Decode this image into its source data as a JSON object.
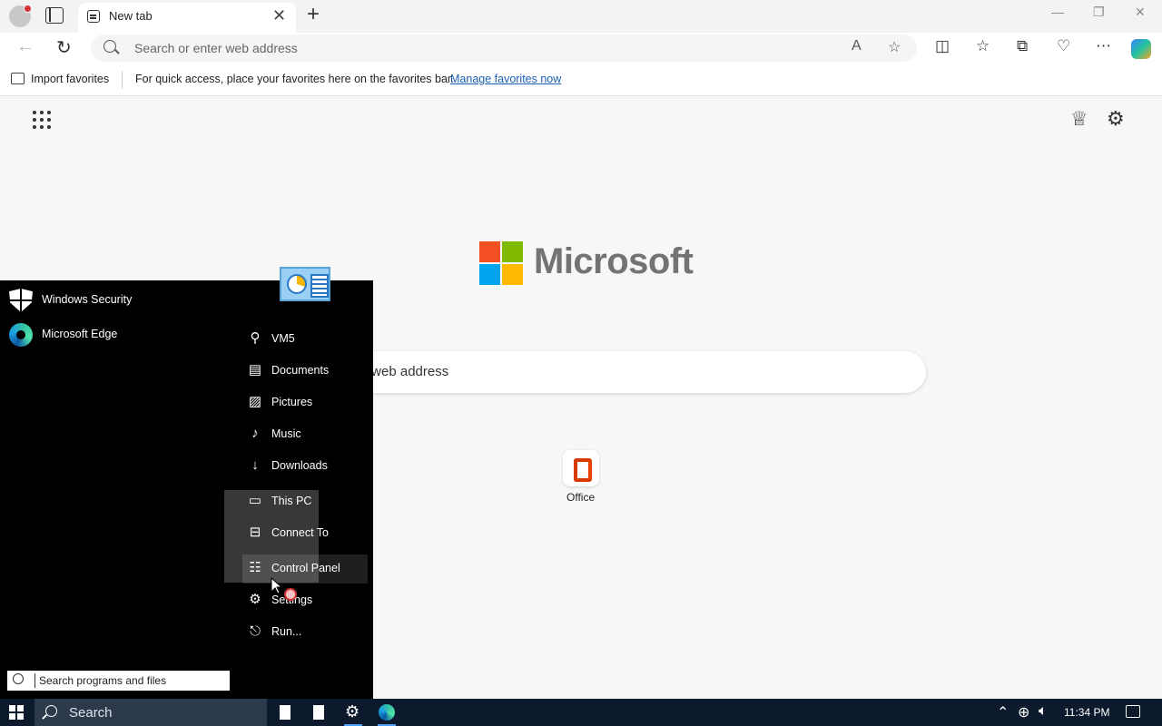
{
  "browser": {
    "tab_title": "New tab",
    "tab_close": "✕",
    "new_tab": "+",
    "address_placeholder": "Search or enter web address",
    "window_controls": {
      "minimize": "—",
      "restore": "❐",
      "close": "✕"
    }
  },
  "favorites_bar": {
    "import_label": "Import favorites",
    "message": "For quick access, place your favorites here on the favorites bar.",
    "manage_link": "Manage favorites now"
  },
  "page": {
    "brand": "Microsoft",
    "search_text": "r web address",
    "quick_links": [
      {
        "label": "Office"
      }
    ],
    "logo_colors": [
      "#f25022",
      "#7fba00",
      "#00a4ef",
      "#ffb900"
    ]
  },
  "start_menu": {
    "pinned": [
      {
        "label": "Windows Security",
        "icon": "shield-icon"
      },
      {
        "label": "Microsoft Edge",
        "icon": "edge-icon"
      }
    ],
    "places": [
      {
        "label": "VM5",
        "icon": "user-icon"
      },
      {
        "label": "Documents",
        "icon": "document-icon"
      },
      {
        "label": "Pictures",
        "icon": "picture-icon"
      },
      {
        "label": "Music",
        "icon": "music-icon"
      },
      {
        "label": "Downloads",
        "icon": "download-icon"
      },
      {
        "label": "This PC",
        "icon": "computer-icon"
      },
      {
        "label": "Connect To",
        "icon": "connect-icon"
      },
      {
        "label": "Control Panel",
        "icon": "control-panel-icon"
      },
      {
        "label": "Settings",
        "icon": "gear-icon"
      },
      {
        "label": "Run...",
        "icon": "run-icon"
      }
    ],
    "search_placeholder": "Search programs and files"
  },
  "taskbar": {
    "search_label": "Search",
    "time": "11:34 PM"
  }
}
